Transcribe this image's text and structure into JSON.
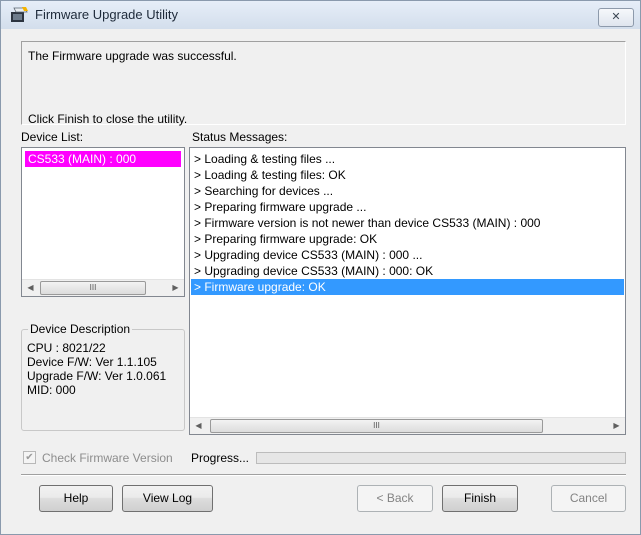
{
  "window": {
    "title": "Firmware Upgrade Utility",
    "close_label": "✕"
  },
  "message": {
    "line1": "The Firmware upgrade was successful.",
    "line2": "Click Finish to close the utility."
  },
  "device_list": {
    "label": "Device List:",
    "items": [
      {
        "label": "CS533 (MAIN) : 000",
        "selected": true,
        "highlight_color": "#ff00ff"
      }
    ]
  },
  "status_messages": {
    "label": "Status Messages:",
    "items": [
      {
        "text": "> Loading & testing files ...",
        "selected": false
      },
      {
        "text": "> Loading & testing files: OK",
        "selected": false
      },
      {
        "text": "> Searching for devices ...",
        "selected": false
      },
      {
        "text": "> Preparing firmware upgrade ...",
        "selected": false
      },
      {
        "text": "> Firmware version is not newer than device CS533 (MAIN) : 000",
        "selected": false
      },
      {
        "text": "> Preparing firmware upgrade: OK",
        "selected": false
      },
      {
        "text": "> Upgrading device CS533 (MAIN) : 000 ...",
        "selected": false
      },
      {
        "text": "> Upgrading device CS533 (MAIN) : 000: OK",
        "selected": false
      },
      {
        "text": "> Firmware upgrade: OK",
        "selected": true
      }
    ],
    "selection_color": "#3399ff"
  },
  "device_description": {
    "legend": "Device Description",
    "cpu": "CPU : 8021/22",
    "device_fw": "Device F/W: Ver 1.1.105",
    "upgrade_fw": "Upgrade F/W: Ver 1.0.061",
    "mid": "MID: 000"
  },
  "options": {
    "check_firmware_label": "Check Firmware Version",
    "check_firmware_checked": true
  },
  "progress": {
    "label": "Progress...",
    "fraction": 0.0
  },
  "buttons": {
    "help": "Help",
    "view_log": "View Log",
    "back": "< Back",
    "finish": "Finish",
    "cancel": "Cancel"
  },
  "scrollbar": {
    "left_arrow": "◀",
    "right_arrow": "▶",
    "thumb_grip": "III"
  }
}
